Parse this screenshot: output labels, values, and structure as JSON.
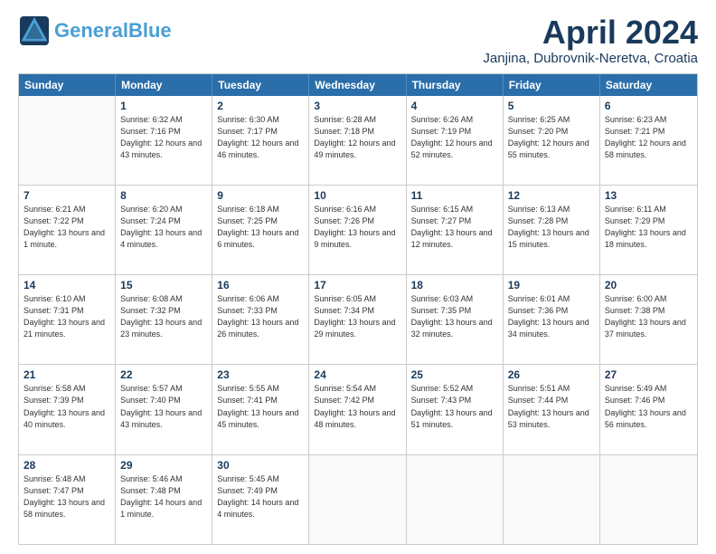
{
  "logo": {
    "line1": "General",
    "line2": "Blue",
    "tagline": ""
  },
  "header": {
    "title": "April 2024",
    "subtitle": "Janjina, Dubrovnik-Neretva, Croatia"
  },
  "weekdays": [
    "Sunday",
    "Monday",
    "Tuesday",
    "Wednesday",
    "Thursday",
    "Friday",
    "Saturday"
  ],
  "weeks": [
    [
      {
        "day": "",
        "sunrise": "",
        "sunset": "",
        "daylight": ""
      },
      {
        "day": "1",
        "sunrise": "Sunrise: 6:32 AM",
        "sunset": "Sunset: 7:16 PM",
        "daylight": "Daylight: 12 hours and 43 minutes."
      },
      {
        "day": "2",
        "sunrise": "Sunrise: 6:30 AM",
        "sunset": "Sunset: 7:17 PM",
        "daylight": "Daylight: 12 hours and 46 minutes."
      },
      {
        "day": "3",
        "sunrise": "Sunrise: 6:28 AM",
        "sunset": "Sunset: 7:18 PM",
        "daylight": "Daylight: 12 hours and 49 minutes."
      },
      {
        "day": "4",
        "sunrise": "Sunrise: 6:26 AM",
        "sunset": "Sunset: 7:19 PM",
        "daylight": "Daylight: 12 hours and 52 minutes."
      },
      {
        "day": "5",
        "sunrise": "Sunrise: 6:25 AM",
        "sunset": "Sunset: 7:20 PM",
        "daylight": "Daylight: 12 hours and 55 minutes."
      },
      {
        "day": "6",
        "sunrise": "Sunrise: 6:23 AM",
        "sunset": "Sunset: 7:21 PM",
        "daylight": "Daylight: 12 hours and 58 minutes."
      }
    ],
    [
      {
        "day": "7",
        "sunrise": "Sunrise: 6:21 AM",
        "sunset": "Sunset: 7:22 PM",
        "daylight": "Daylight: 13 hours and 1 minute."
      },
      {
        "day": "8",
        "sunrise": "Sunrise: 6:20 AM",
        "sunset": "Sunset: 7:24 PM",
        "daylight": "Daylight: 13 hours and 4 minutes."
      },
      {
        "day": "9",
        "sunrise": "Sunrise: 6:18 AM",
        "sunset": "Sunset: 7:25 PM",
        "daylight": "Daylight: 13 hours and 6 minutes."
      },
      {
        "day": "10",
        "sunrise": "Sunrise: 6:16 AM",
        "sunset": "Sunset: 7:26 PM",
        "daylight": "Daylight: 13 hours and 9 minutes."
      },
      {
        "day": "11",
        "sunrise": "Sunrise: 6:15 AM",
        "sunset": "Sunset: 7:27 PM",
        "daylight": "Daylight: 13 hours and 12 minutes."
      },
      {
        "day": "12",
        "sunrise": "Sunrise: 6:13 AM",
        "sunset": "Sunset: 7:28 PM",
        "daylight": "Daylight: 13 hours and 15 minutes."
      },
      {
        "day": "13",
        "sunrise": "Sunrise: 6:11 AM",
        "sunset": "Sunset: 7:29 PM",
        "daylight": "Daylight: 13 hours and 18 minutes."
      }
    ],
    [
      {
        "day": "14",
        "sunrise": "Sunrise: 6:10 AM",
        "sunset": "Sunset: 7:31 PM",
        "daylight": "Daylight: 13 hours and 21 minutes."
      },
      {
        "day": "15",
        "sunrise": "Sunrise: 6:08 AM",
        "sunset": "Sunset: 7:32 PM",
        "daylight": "Daylight: 13 hours and 23 minutes."
      },
      {
        "day": "16",
        "sunrise": "Sunrise: 6:06 AM",
        "sunset": "Sunset: 7:33 PM",
        "daylight": "Daylight: 13 hours and 26 minutes."
      },
      {
        "day": "17",
        "sunrise": "Sunrise: 6:05 AM",
        "sunset": "Sunset: 7:34 PM",
        "daylight": "Daylight: 13 hours and 29 minutes."
      },
      {
        "day": "18",
        "sunrise": "Sunrise: 6:03 AM",
        "sunset": "Sunset: 7:35 PM",
        "daylight": "Daylight: 13 hours and 32 minutes."
      },
      {
        "day": "19",
        "sunrise": "Sunrise: 6:01 AM",
        "sunset": "Sunset: 7:36 PM",
        "daylight": "Daylight: 13 hours and 34 minutes."
      },
      {
        "day": "20",
        "sunrise": "Sunrise: 6:00 AM",
        "sunset": "Sunset: 7:38 PM",
        "daylight": "Daylight: 13 hours and 37 minutes."
      }
    ],
    [
      {
        "day": "21",
        "sunrise": "Sunrise: 5:58 AM",
        "sunset": "Sunset: 7:39 PM",
        "daylight": "Daylight: 13 hours and 40 minutes."
      },
      {
        "day": "22",
        "sunrise": "Sunrise: 5:57 AM",
        "sunset": "Sunset: 7:40 PM",
        "daylight": "Daylight: 13 hours and 43 minutes."
      },
      {
        "day": "23",
        "sunrise": "Sunrise: 5:55 AM",
        "sunset": "Sunset: 7:41 PM",
        "daylight": "Daylight: 13 hours and 45 minutes."
      },
      {
        "day": "24",
        "sunrise": "Sunrise: 5:54 AM",
        "sunset": "Sunset: 7:42 PM",
        "daylight": "Daylight: 13 hours and 48 minutes."
      },
      {
        "day": "25",
        "sunrise": "Sunrise: 5:52 AM",
        "sunset": "Sunset: 7:43 PM",
        "daylight": "Daylight: 13 hours and 51 minutes."
      },
      {
        "day": "26",
        "sunrise": "Sunrise: 5:51 AM",
        "sunset": "Sunset: 7:44 PM",
        "daylight": "Daylight: 13 hours and 53 minutes."
      },
      {
        "day": "27",
        "sunrise": "Sunrise: 5:49 AM",
        "sunset": "Sunset: 7:46 PM",
        "daylight": "Daylight: 13 hours and 56 minutes."
      }
    ],
    [
      {
        "day": "28",
        "sunrise": "Sunrise: 5:48 AM",
        "sunset": "Sunset: 7:47 PM",
        "daylight": "Daylight: 13 hours and 58 minutes."
      },
      {
        "day": "29",
        "sunrise": "Sunrise: 5:46 AM",
        "sunset": "Sunset: 7:48 PM",
        "daylight": "Daylight: 14 hours and 1 minute."
      },
      {
        "day": "30",
        "sunrise": "Sunrise: 5:45 AM",
        "sunset": "Sunset: 7:49 PM",
        "daylight": "Daylight: 14 hours and 4 minutes."
      },
      {
        "day": "",
        "sunrise": "",
        "sunset": "",
        "daylight": ""
      },
      {
        "day": "",
        "sunrise": "",
        "sunset": "",
        "daylight": ""
      },
      {
        "day": "",
        "sunrise": "",
        "sunset": "",
        "daylight": ""
      },
      {
        "day": "",
        "sunrise": "",
        "sunset": "",
        "daylight": ""
      }
    ]
  ]
}
